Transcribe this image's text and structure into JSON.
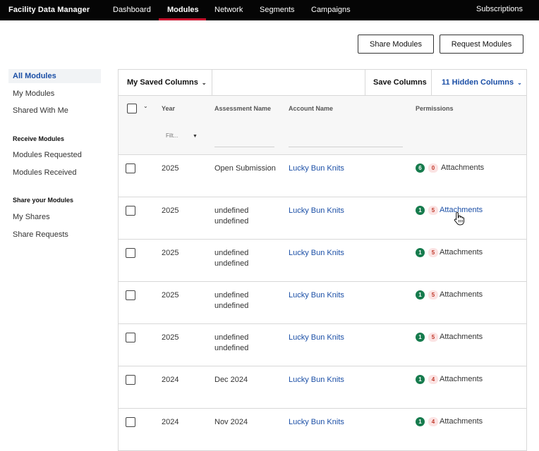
{
  "app": {
    "title": "Facility Data Manager"
  },
  "nav": {
    "items": [
      "Dashboard",
      "Modules",
      "Network",
      "Segments",
      "Campaigns"
    ],
    "active": "Modules",
    "subscriptions": "Subscriptions"
  },
  "actions": {
    "share": "Share Modules",
    "request": "Request Modules"
  },
  "sidebar": {
    "top": [
      "All Modules",
      "My Modules",
      "Shared With Me"
    ],
    "receive_heading": "Receive Modules",
    "receive": [
      "Modules Requested",
      "Modules Received"
    ],
    "share_heading": "Share your Modules",
    "share": [
      "My Shares",
      "Share Requests"
    ]
  },
  "toolbar": {
    "saved_columns": "My Saved Columns",
    "save_columns": "Save Columns",
    "hidden_columns": "11 Hidden Columns"
  },
  "table": {
    "headers": {
      "year": "Year",
      "assessment": "Assessment Name",
      "account": "Account Name",
      "permissions": "Permissions"
    },
    "year_filter_placeholder": "Filt...",
    "rows": [
      {
        "year": "2025",
        "assessment": "Open Submission",
        "account": "Lucky Bun Knits",
        "green": "6",
        "red": "0",
        "attachments": "Attachments"
      },
      {
        "year": "2025",
        "assessment": "undefined\nundefined",
        "account": "Lucky Bun Knits",
        "green": "1",
        "red": "5",
        "attachments": "Attachments"
      },
      {
        "year": "2025",
        "assessment": "undefined\nundefined",
        "account": "Lucky Bun Knits",
        "green": "1",
        "red": "5",
        "attachments": "Attachments"
      },
      {
        "year": "2025",
        "assessment": "undefined\nundefined",
        "account": "Lucky Bun Knits",
        "green": "1",
        "red": "5",
        "attachments": "Attachments"
      },
      {
        "year": "2025",
        "assessment": "undefined\nundefined",
        "account": "Lucky Bun Knits",
        "green": "1",
        "red": "5",
        "attachments": "Attachments"
      },
      {
        "year": "2024",
        "assessment": "Dec 2024",
        "account": "Lucky Bun Knits",
        "green": "1",
        "red": "4",
        "attachments": "Attachments"
      },
      {
        "year": "2024",
        "assessment": "Nov 2024",
        "account": "Lucky Bun Knits",
        "green": "1",
        "red": "4",
        "attachments": "Attachments"
      }
    ]
  },
  "colors": {
    "accent": "#c8102e",
    "link": "#1b4fa6",
    "badge_green": "#167b4d",
    "badge_red_bg": "#fbe3e3"
  }
}
